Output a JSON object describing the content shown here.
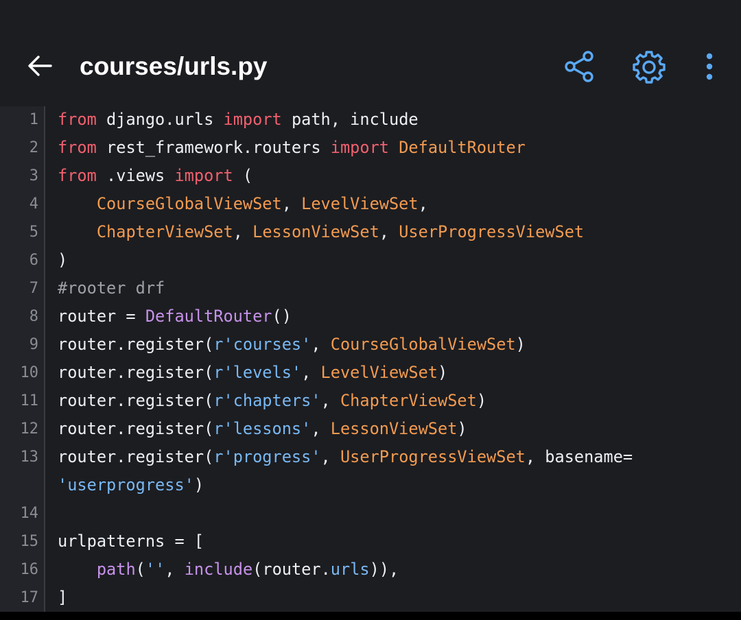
{
  "appbar": {
    "title": "courses/urls.py",
    "back_icon": "arrow-left-icon",
    "share_icon": "share-icon",
    "settings_icon": "gear-icon",
    "more_icon": "more-vertical-icon",
    "accent_color": "#5aa9f5"
  },
  "editor": {
    "colors": {
      "keyword": "#f0606e",
      "class": "#f29b50",
      "function": "#c792ea",
      "string": "#79b8f2",
      "comment": "#9ea1a8",
      "plain": "#eceff4"
    },
    "lines": [
      {
        "number": "1",
        "tokens": [
          {
            "t": "from",
            "k": "kw"
          },
          {
            "t": " django.urls ",
            "k": "plain"
          },
          {
            "t": "import",
            "k": "kw"
          },
          {
            "t": " path, include",
            "k": "plain"
          }
        ]
      },
      {
        "number": "2",
        "tokens": [
          {
            "t": "from",
            "k": "kw"
          },
          {
            "t": " rest_framework.routers ",
            "k": "plain"
          },
          {
            "t": "import",
            "k": "kw"
          },
          {
            "t": " ",
            "k": "plain"
          },
          {
            "t": "DefaultRouter",
            "k": "cls"
          }
        ]
      },
      {
        "number": "3",
        "tokens": [
          {
            "t": "from",
            "k": "kw"
          },
          {
            "t": " .views ",
            "k": "plain"
          },
          {
            "t": "import",
            "k": "kw"
          },
          {
            "t": " (",
            "k": "plain"
          }
        ]
      },
      {
        "number": "4",
        "tokens": [
          {
            "t": "    ",
            "k": "plain"
          },
          {
            "t": "CourseGlobalViewSet",
            "k": "cls"
          },
          {
            "t": ", ",
            "k": "plain"
          },
          {
            "t": "LevelViewSet",
            "k": "cls"
          },
          {
            "t": ",",
            "k": "plain"
          }
        ]
      },
      {
        "number": "5",
        "tokens": [
          {
            "t": "    ",
            "k": "plain"
          },
          {
            "t": "ChapterViewSet",
            "k": "cls"
          },
          {
            "t": ", ",
            "k": "plain"
          },
          {
            "t": "LessonViewSet",
            "k": "cls"
          },
          {
            "t": ", ",
            "k": "plain"
          },
          {
            "t": "UserProgressViewSet",
            "k": "cls"
          }
        ]
      },
      {
        "number": "6",
        "tokens": [
          {
            "t": ")",
            "k": "plain"
          }
        ]
      },
      {
        "number": "7",
        "tokens": [
          {
            "t": "#rooter drf",
            "k": "cmt"
          }
        ]
      },
      {
        "number": "8",
        "tokens": [
          {
            "t": "router = ",
            "k": "plain"
          },
          {
            "t": "DefaultRouter",
            "k": "fn"
          },
          {
            "t": "()",
            "k": "plain"
          }
        ]
      },
      {
        "number": "9",
        "tokens": [
          {
            "t": "router.register(",
            "k": "plain"
          },
          {
            "t": "r'courses'",
            "k": "str"
          },
          {
            "t": ", ",
            "k": "plain"
          },
          {
            "t": "CourseGlobalViewSet",
            "k": "cls"
          },
          {
            "t": ")",
            "k": "plain"
          }
        ]
      },
      {
        "number": "10",
        "tokens": [
          {
            "t": "router.register(",
            "k": "plain"
          },
          {
            "t": "r'levels'",
            "k": "str"
          },
          {
            "t": ", ",
            "k": "plain"
          },
          {
            "t": "LevelViewSet",
            "k": "cls"
          },
          {
            "t": ")",
            "k": "plain"
          }
        ]
      },
      {
        "number": "11",
        "tokens": [
          {
            "t": "router.register(",
            "k": "plain"
          },
          {
            "t": "r'chapters'",
            "k": "str"
          },
          {
            "t": ", ",
            "k": "plain"
          },
          {
            "t": "ChapterViewSet",
            "k": "cls"
          },
          {
            "t": ")",
            "k": "plain"
          }
        ]
      },
      {
        "number": "12",
        "tokens": [
          {
            "t": "router.register(",
            "k": "plain"
          },
          {
            "t": "r'lessons'",
            "k": "str"
          },
          {
            "t": ", ",
            "k": "plain"
          },
          {
            "t": "LessonViewSet",
            "k": "cls"
          },
          {
            "t": ")",
            "k": "plain"
          }
        ]
      },
      {
        "number": "13",
        "tokens": [
          {
            "t": "router.register(",
            "k": "plain"
          },
          {
            "t": "r'progress'",
            "k": "str"
          },
          {
            "t": ", ",
            "k": "plain"
          },
          {
            "t": "UserProgressViewSet",
            "k": "cls"
          },
          {
            "t": ", basename=",
            "k": "plain"
          }
        ]
      },
      {
        "number": "",
        "tokens": [
          {
            "t": "'userprogress'",
            "k": "str"
          },
          {
            "t": ")",
            "k": "plain"
          }
        ]
      },
      {
        "number": "14",
        "tokens": []
      },
      {
        "number": "15",
        "tokens": [
          {
            "t": "urlpatterns = [",
            "k": "plain"
          }
        ]
      },
      {
        "number": "16",
        "tokens": [
          {
            "t": "    ",
            "k": "plain"
          },
          {
            "t": "path",
            "k": "fn"
          },
          {
            "t": "(",
            "k": "plain"
          },
          {
            "t": "''",
            "k": "str"
          },
          {
            "t": ", ",
            "k": "plain"
          },
          {
            "t": "include",
            "k": "fn"
          },
          {
            "t": "(router.",
            "k": "plain"
          },
          {
            "t": "urls",
            "k": "str"
          },
          {
            "t": ")),",
            "k": "plain"
          }
        ]
      },
      {
        "number": "17",
        "tokens": [
          {
            "t": "]",
            "k": "plain"
          }
        ]
      }
    ]
  }
}
